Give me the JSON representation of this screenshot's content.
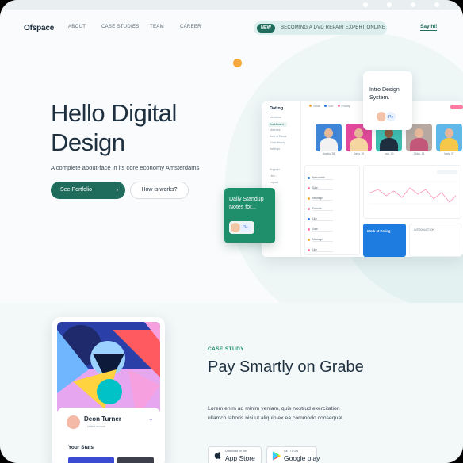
{
  "nav": {
    "logo": "Ofspace",
    "links": [
      "ABOUT",
      "CASE STUDIES",
      "TEAM",
      "CAREER"
    ],
    "announcement_tag": "NEW",
    "announcement_text": "BECOMING A DVD REPAIR EXPERT ONLINE",
    "cta": "Say hi!"
  },
  "hero": {
    "title": "Hello Digital Design",
    "subtitle": "A complete about-face in its core economy Amsterdams",
    "primary_button": "See Portfolio",
    "secondary_button": "How is works?"
  },
  "floating": {
    "intro_card": "Intro Design System.",
    "standup_card": "Daily Standup Notes for..."
  },
  "dashboard": {
    "title": "Dating",
    "side_items": [
      "Members",
      "Dashboard",
      "Matches",
      "Best of Dates",
      "Chat History",
      "Settings",
      "Support",
      "Help",
      "Logout"
    ],
    "filters": [
      "Value",
      "Sort",
      "Priority"
    ],
    "photo_names": [
      "Amelia, 28",
      "Daisy, 26",
      "Jack, 30",
      "Chloe, 24",
      "Mary, 27"
    ],
    "activity_rows": [
      "New match",
      "Date",
      "Message",
      "Favorite",
      "Like",
      "Date",
      "Message",
      "Like"
    ],
    "card_blue": "Work at Dating",
    "card_plain": "INTRODUCTION"
  },
  "case_study": {
    "label": "CASE STUDY",
    "title": "Pay Smartly on Grabe",
    "body": "Lorem enim ad minim veniam, quis nostrud exercitation ullamco laboris nisi ut aliquip ex ea commodo consequat.",
    "app_store_small": "Download on the",
    "app_store_big": "App Store",
    "google_small": "GET IT ON",
    "google_big": "Google play"
  },
  "phone_card": {
    "name": "Deon Turner",
    "location": "United account",
    "stats_title": "Your Stats",
    "plus": "+"
  },
  "colors": {
    "brand_green": "#1f6b5c",
    "accent_orange": "#f5a93b",
    "accent_blue": "#1e7be0",
    "accent_pink": "#ff7aa2"
  }
}
